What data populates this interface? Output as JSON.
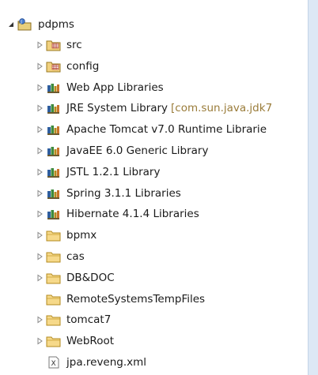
{
  "project": {
    "name": "pdpms",
    "items": [
      {
        "label": "src",
        "icon": "source-folder-icon",
        "expandable": true
      },
      {
        "label": "config",
        "icon": "source-folder-icon",
        "expandable": true
      },
      {
        "label": "Web App Libraries",
        "icon": "library-icon",
        "expandable": true
      },
      {
        "label": "JRE System Library",
        "decorator": "[com.sun.java.jdk7",
        "icon": "library-icon",
        "expandable": true
      },
      {
        "label": "Apache Tomcat v7.0 Runtime Librarie",
        "icon": "library-icon",
        "expandable": true
      },
      {
        "label": "JavaEE 6.0 Generic Library",
        "icon": "library-icon",
        "expandable": true
      },
      {
        "label": "JSTL 1.2.1 Library",
        "icon": "library-icon",
        "expandable": true
      },
      {
        "label": "Spring 3.1.1 Libraries",
        "icon": "library-icon",
        "expandable": true
      },
      {
        "label": "Hibernate 4.1.4 Libraries",
        "icon": "library-icon",
        "expandable": true
      },
      {
        "label": "bpmx",
        "icon": "folder-icon",
        "expandable": true
      },
      {
        "label": "cas",
        "icon": "folder-icon",
        "expandable": true
      },
      {
        "label": "DB&DOC",
        "icon": "folder-icon",
        "expandable": true
      },
      {
        "label": "RemoteSystemsTempFiles",
        "icon": "folder-icon",
        "expandable": false
      },
      {
        "label": "tomcat7",
        "icon": "folder-icon",
        "expandable": true
      },
      {
        "label": "WebRoot",
        "icon": "folder-icon",
        "expandable": true
      },
      {
        "label": "jpa.reveng.xml",
        "icon": "xml-file-icon",
        "expandable": false
      }
    ]
  }
}
